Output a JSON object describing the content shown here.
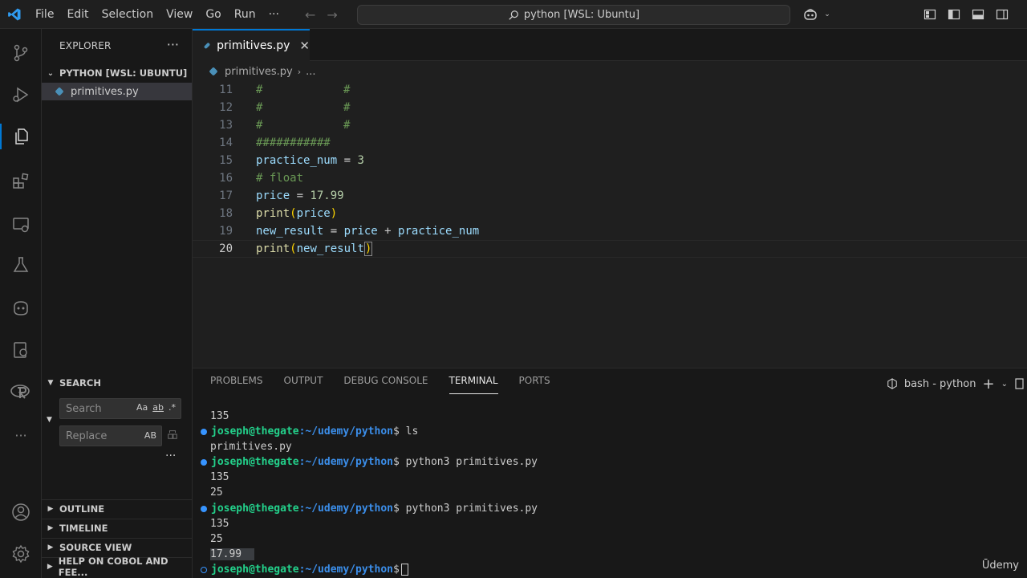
{
  "menu": [
    "File",
    "Edit",
    "Selection",
    "View",
    "Go",
    "Run",
    "···"
  ],
  "command_center": "python [WSL: Ubuntu]",
  "explorer": {
    "title": "EXPLORER",
    "folder": "PYTHON [WSL: UBUNTU]",
    "file": "primitives.py"
  },
  "search": {
    "title": "SEARCH",
    "search_placeholder": "Search",
    "replace_placeholder": "Replace",
    "opt_case": "Aa",
    "opt_word": "ab",
    "opt_regex": ".*",
    "opt_preserve": "AB"
  },
  "collapsed_sections": [
    "OUTLINE",
    "TIMELINE",
    "SOURCE VIEW",
    "HELP ON COBOL AND FEE..."
  ],
  "tab": {
    "label": "primitives.py"
  },
  "breadcrumb": {
    "file": "primitives.py",
    "rest": "..."
  },
  "editor": {
    "lines": [
      {
        "n": "11"
      },
      {
        "n": "12"
      },
      {
        "n": "13"
      },
      {
        "n": "14"
      },
      {
        "n": "15"
      },
      {
        "n": "16"
      },
      {
        "n": "17"
      },
      {
        "n": "18"
      },
      {
        "n": "19"
      },
      {
        "n": "20"
      }
    ],
    "code": {
      "l11a": "#",
      "l11b": "#",
      "l12a": "#",
      "l12b": "#",
      "l13a": "#",
      "l13b": "#",
      "l14": "###########",
      "l15_var": "practice_num",
      "l15_op": " = ",
      "l15_num": "3",
      "l16": "# float",
      "l17_var": "price",
      "l17_op": " = ",
      "l17_num": "17.99",
      "l18_fn": "print",
      "l18_open": "(",
      "l18_arg": "price",
      "l18_close": ")",
      "l19_var": "new_result",
      "l19_op1": " = ",
      "l19_a": "price",
      "l19_op2": " + ",
      "l19_b": "practice_num",
      "l20_fn": "print",
      "l20_open": "(",
      "l20_arg": "new_result",
      "l20_close": ")"
    }
  },
  "panel": {
    "tabs": [
      "PROBLEMS",
      "OUTPUT",
      "DEBUG CONSOLE",
      "TERMINAL",
      "PORTS"
    ],
    "active_tab": "TERMINAL",
    "terminal_name": "bash - python"
  },
  "terminal": {
    "user": "joseph@thegate",
    "path": ":~/udemy/python",
    "sym": "$",
    "out1": "135",
    "cmd1": " ls",
    "out2": "primitives.py",
    "cmd2": " python3 primitives.py",
    "out3": "135",
    "out4": "25",
    "cmd3": " python3 primitives.py",
    "out5": "135",
    "out6": "25",
    "out7": "17.99"
  },
  "watermark": "Ūdemy",
  "colors": {
    "accent": "#0078d4",
    "comment": "#6a9955",
    "variable": "#9cdcfe",
    "number": "#b5cea8",
    "function": "#dcdcaa",
    "prompt_user": "#23d18b",
    "prompt_path": "#3b8eea"
  }
}
